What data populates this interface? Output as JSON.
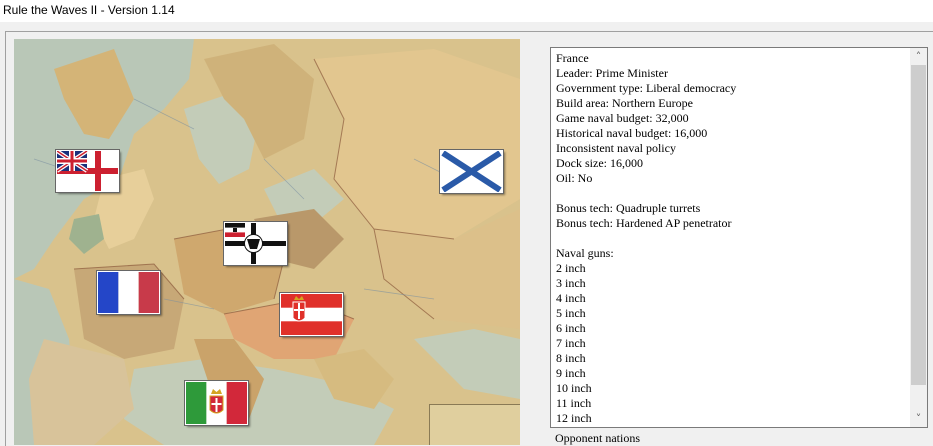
{
  "window": {
    "title": "Rule the Waves II - Version 1.14"
  },
  "map": {
    "name": "Europe map",
    "flags": [
      {
        "nation": "Britain",
        "icon": "white-ensign-flag-icon"
      },
      {
        "nation": "Russia",
        "icon": "st-andrews-naval-ensign-flag-icon"
      },
      {
        "nation": "Germany",
        "icon": "imperial-german-war-ensign-flag-icon"
      },
      {
        "nation": "France",
        "icon": "french-tricolour-flag-icon"
      },
      {
        "nation": "Austria-Hungary",
        "icon": "austro-hungarian-naval-ensign-flag-icon"
      },
      {
        "nation": "Italy",
        "icon": "italian-naval-ensign-flag-icon"
      }
    ]
  },
  "info": {
    "lines": [
      "France",
      "Leader: Prime Minister",
      "Government type: Liberal democracy",
      "Build area: Northern Europe",
      "Game naval budget: 32,000",
      "Historical naval budget: 16,000",
      "Inconsistent naval policy",
      "Dock size: 16,000",
      "Oil: No",
      "",
      "Bonus tech: Quadruple turrets",
      "Bonus tech: Hardened AP penetrator",
      "",
      "Naval guns:",
      "2 inch",
      "3 inch",
      "4 inch",
      "5 inch",
      "6 inch",
      "7 inch",
      "8 inch",
      "9 inch",
      "10 inch",
      "11 inch",
      "12 inch"
    ],
    "scroll_up": "˄",
    "scroll_down": "˅"
  },
  "opponents_label": "Opponent nations"
}
